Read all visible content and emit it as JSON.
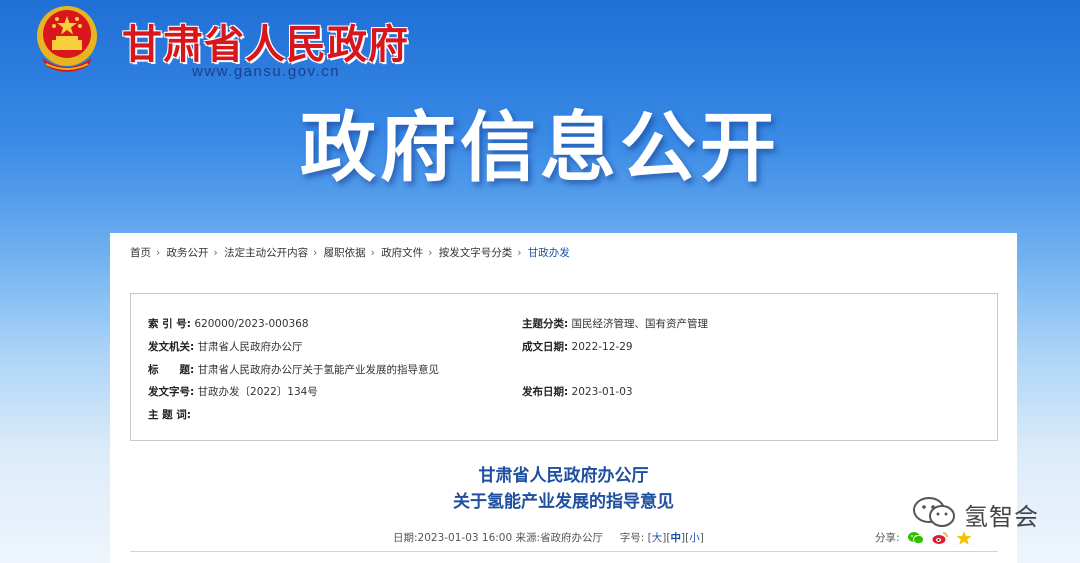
{
  "header": {
    "site_name": "甘肃省人民政府",
    "site_url": "www.gansu.gov.cn",
    "banner_title": "政府信息公开"
  },
  "breadcrumb": [
    "首页",
    "政务公开",
    "法定主动公开内容",
    "履职依据",
    "政府文件",
    "按发文字号分类",
    "甘政办发"
  ],
  "meta": {
    "index_label": "索 引 号:",
    "index_value": "620000/2023-000368",
    "topic_label": "主题分类:",
    "topic_value": "国民经济管理、国有资产管理",
    "issuer_label": "发文机关:",
    "issuer_value": "甘肃省人民政府办公厅",
    "date_written_label": "成文日期:",
    "date_written_value": "2022-12-29",
    "title_label": "标　　题:",
    "title_value": "甘肃省人民政府办公厅关于氢能产业发展的指导意见",
    "doc_no_label": "发文字号:",
    "doc_no_value": "甘政办发〔2022〕134号",
    "publish_date_label": "发布日期:",
    "publish_date_value": "2023-01-03",
    "keywords_label": "主 题 词:",
    "keywords_value": ""
  },
  "document": {
    "title_line1": "甘肃省人民政府办公厅",
    "title_line2": "关于氢能产业发展的指导意见",
    "date_label": "日期:",
    "date_value": "2023-01-03 16:00",
    "source_label": "来源:",
    "source_value": "省政府办公厅",
    "font_size_label": "字号:",
    "size_large": "大",
    "size_medium": "中",
    "size_small": "小",
    "share_label": "分享:"
  },
  "watermark": {
    "text": "氢智会"
  },
  "colors": {
    "brand_red": "#d8161b",
    "link_blue": "#1e4fa0"
  }
}
